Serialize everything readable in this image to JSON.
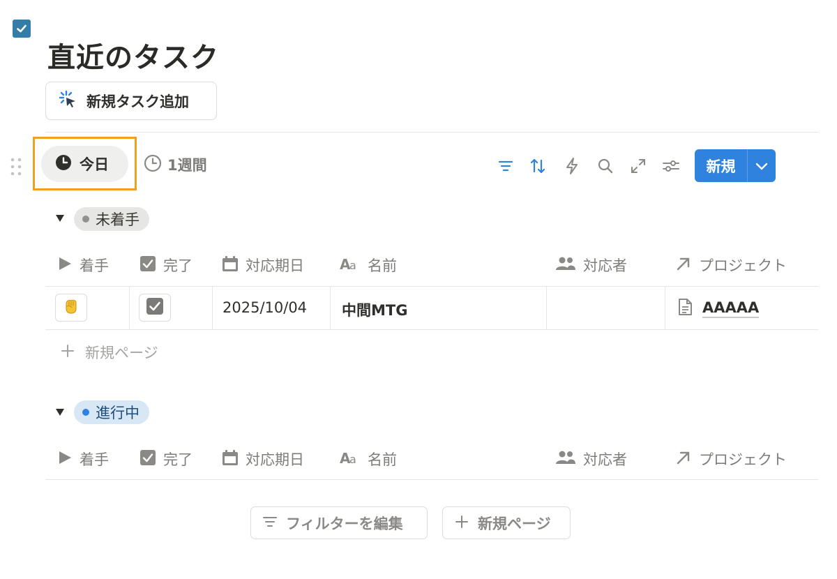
{
  "page": {
    "title": "直近のタスク",
    "icon": "checkbox-icon"
  },
  "add_task_button": {
    "label": "新規タスク追加",
    "icon": "cursor-click-icon"
  },
  "views": [
    {
      "label": "今日",
      "icon": "clock-icon",
      "active": true
    },
    {
      "label": "1週間",
      "icon": "clock-outline-icon",
      "active": false
    }
  ],
  "toolbar": {
    "icons": [
      "filter-icon",
      "sort-icon",
      "automation-icon",
      "search-icon",
      "expand-icon",
      "settings-icon"
    ],
    "new_button": {
      "label": "新規",
      "dropdown_icon": "chevron-down-icon"
    }
  },
  "columns": [
    {
      "label": "着手",
      "icon": "play-icon"
    },
    {
      "label": "完了",
      "icon": "checkbox-icon"
    },
    {
      "label": "対応期日",
      "icon": "calendar-icon"
    },
    {
      "label": "名前",
      "icon": "text-aa-icon"
    },
    {
      "label": "対応者",
      "icon": "people-icon"
    },
    {
      "label": "プロジェクト",
      "icon": "relation-arrow-icon"
    }
  ],
  "groups": [
    {
      "status": "未着手",
      "dot_color": "#91918e",
      "pill_bg": "#e6e6e4",
      "rows": [
        {
          "start_icon": "raised-fist-icon",
          "done": true,
          "due": "2025/10/04",
          "name": "中間MTG",
          "assignee": "",
          "project": "AAAAA"
        }
      ],
      "new_page_label": "新規ページ"
    },
    {
      "status": "進行中",
      "dot_color": "#2f83de",
      "pill_bg": "#d7e7f5",
      "rows": []
    }
  ],
  "footer": {
    "edit_filter_label": "フィルターを編集",
    "new_page_label": "新規ページ"
  },
  "colors": {
    "accent": "#2f83de",
    "highlight": "#f0a020"
  }
}
